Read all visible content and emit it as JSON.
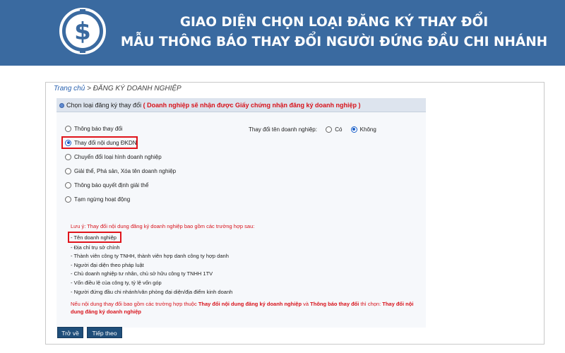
{
  "banner": {
    "title_line1": "GIAO DIỆN CHỌN LOẠI ĐĂNG KÝ THAY ĐỔI",
    "title_line2": "MẪU THÔNG BÁO THAY ĐỔI NGƯỜI ĐỨNG ĐẦU CHI NHÁNH",
    "bg_color": "#3a6aa0",
    "logo_icon": "dollar-coin-icon"
  },
  "breadcrumb": {
    "home": "Trang chủ",
    "separator": " > ",
    "current": "ĐĂNG KÝ DOANH NGHIỆP"
  },
  "panel": {
    "title": "Chọn loại đăng ký thay đổi",
    "title_note": "( Doanh nghiệp sẽ nhận được Giấy chứng nhận đăng ký doanh nghiệp )"
  },
  "options": [
    {
      "label": "Thông báo thay đổi",
      "selected": false
    },
    {
      "label": "Thay đổi nội dung ĐKDN",
      "selected": true
    },
    {
      "label": "Chuyển đổi loại hình doanh nghiệp",
      "selected": false
    },
    {
      "label": "Giải thể, Phá sản, Xóa tên doanh nghiệp",
      "selected": false
    },
    {
      "label": "Thông báo quyết định giải thể",
      "selected": false
    },
    {
      "label": "Tạm ngừng hoạt động",
      "selected": false
    }
  ],
  "name_change": {
    "label": "Thay đổi tên doanh nghiệp:",
    "yes": "Có",
    "no": "Không",
    "selected": "Không"
  },
  "notes": {
    "intro": "Lưu ý: Thay đổi nội dung đăng ký doanh nghiệp bao gồm các trường hợp sau:",
    "items": [
      "- Tên doanh nghiệp",
      "- Địa chỉ trụ sở chính",
      "- Thành viên công ty TNHH, thành viên hợp danh công ty hợp danh",
      "- Người đại diện theo pháp luật",
      "- Chủ doanh nghiệp tư nhân, chủ sở hữu công ty TNHH 1TV",
      "- Vốn điều lệ của công ty, tỷ lệ vốn góp",
      "- Người đứng đầu chi nhánh/văn phòng đại diện/địa điểm kinh doanh"
    ],
    "warn_1": "Nếu nội dung thay đổi bao gồm các trường hợp thuộc ",
    "warn_2": "Thay đổi nội dung đăng ký doanh nghiệp",
    "warn_3": " và ",
    "warn_4": "Thông báo thay đổi",
    "warn_5": " thì chọn: ",
    "warn_6": "Thay đổi nội dung đăng ký doanh nghiệp"
  },
  "buttons": {
    "back": "Trở về",
    "next": "Tiếp theo"
  },
  "colors": {
    "accent_red": "#e0141b",
    "button_blue": "#1f4e7a"
  }
}
